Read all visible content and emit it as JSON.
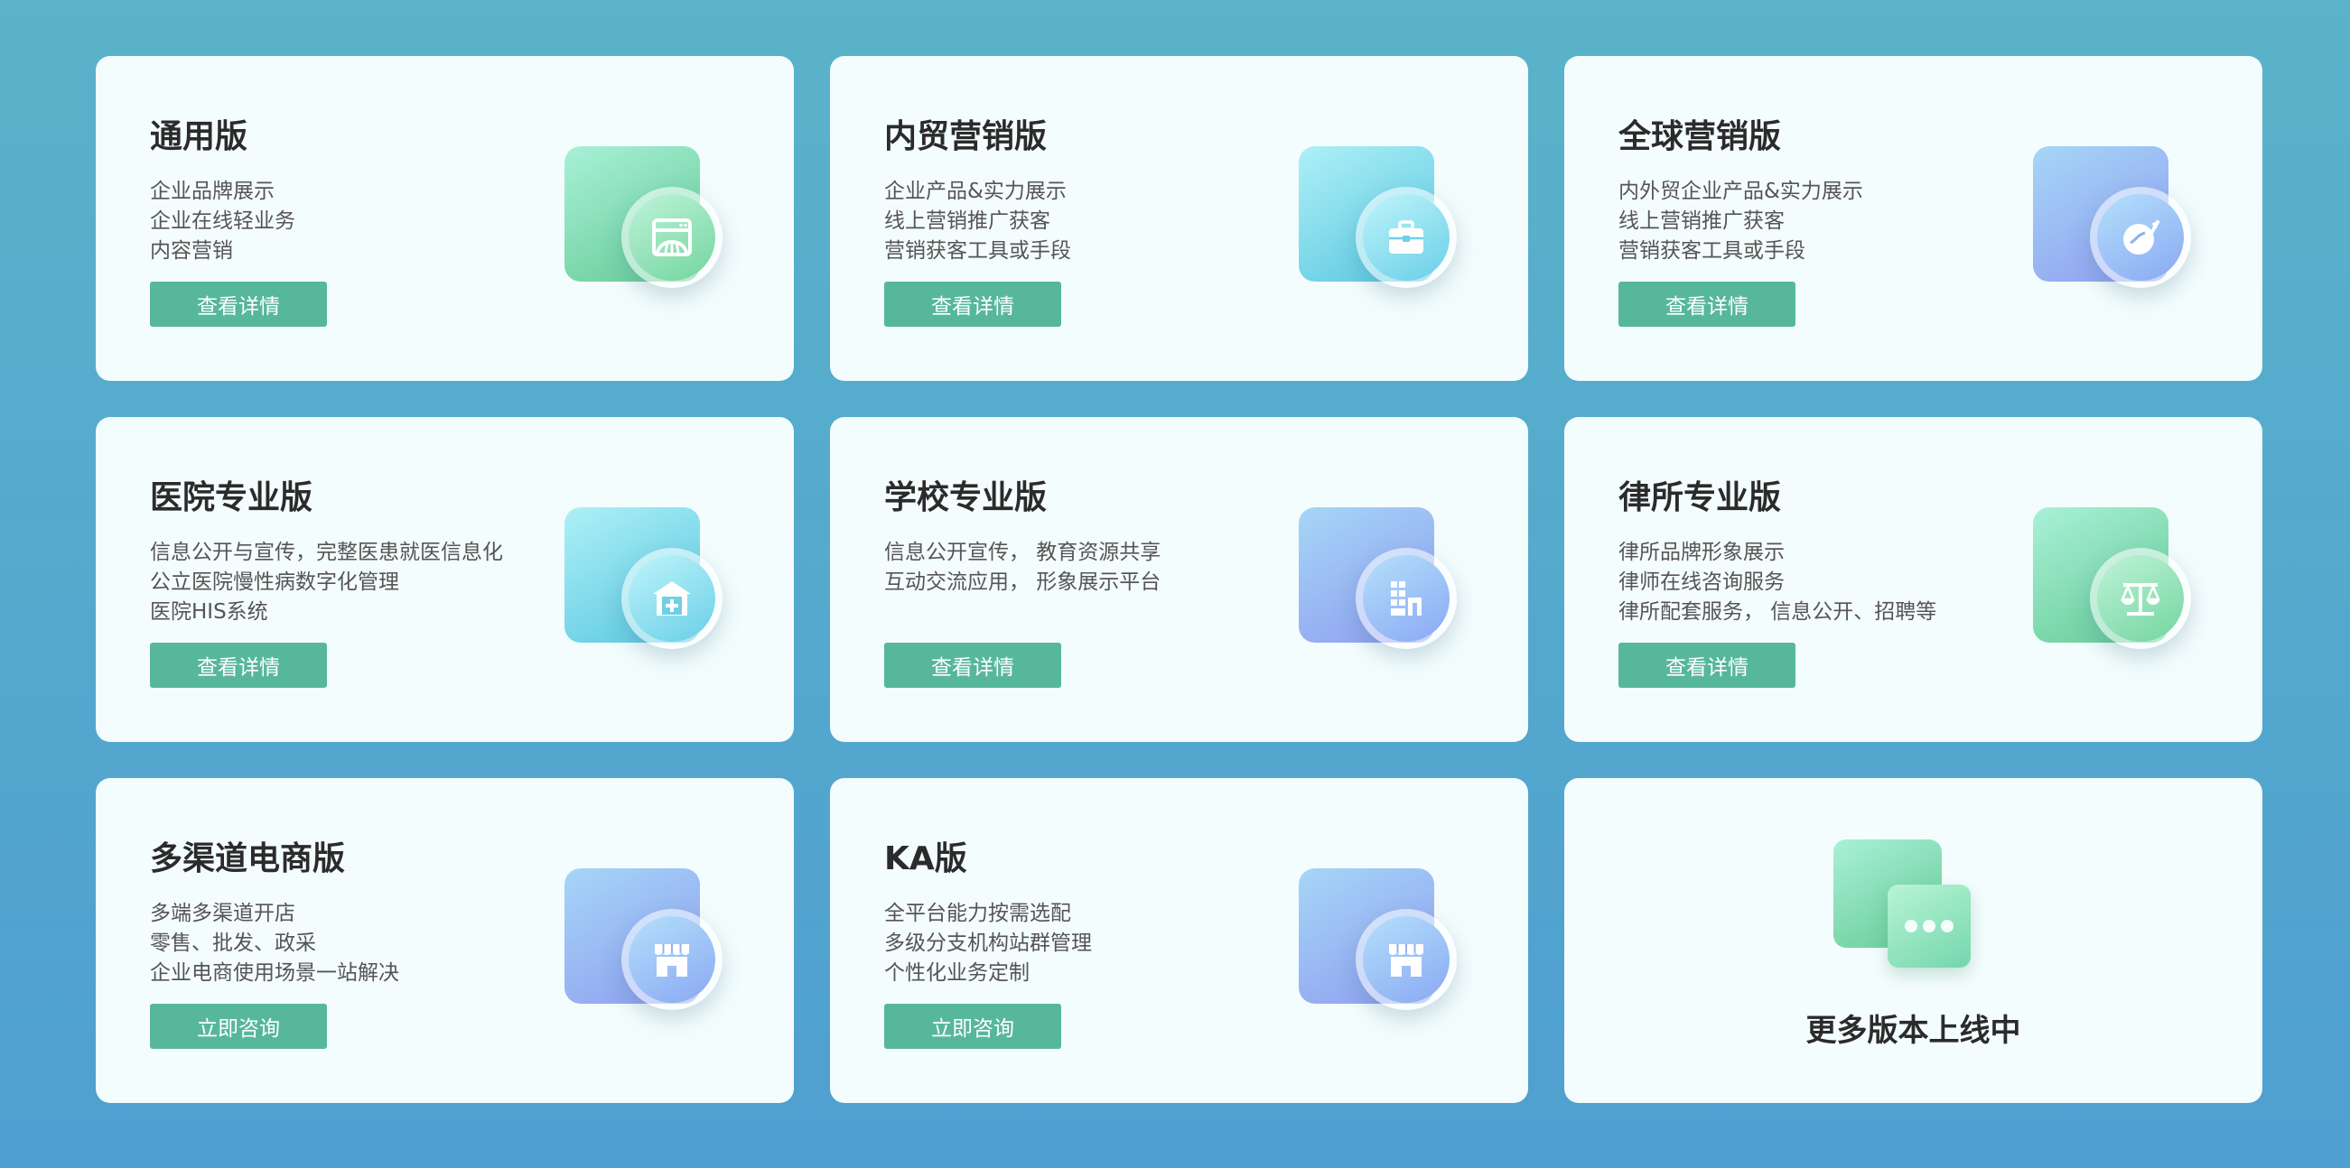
{
  "cards": [
    {
      "title": "通用版",
      "lines": [
        "企业品牌展示",
        "企业在线轻业务",
        "内容营销"
      ],
      "button": "查看详情",
      "icon": "storefront-icon",
      "theme": "green"
    },
    {
      "title": "内贸营销版",
      "lines": [
        "企业产品&实力展示",
        "线上营销推广获客",
        "营销获客工具或手段"
      ],
      "button": "查看详情",
      "icon": "briefcase-icon",
      "theme": "cyan"
    },
    {
      "title": "全球营销版",
      "lines": [
        "内外贸企业产品&实力展示",
        "线上营销推广获客",
        "营销获客工具或手段"
      ],
      "button": "查看详情",
      "icon": "globe-icon",
      "theme": "blue"
    },
    {
      "title": "医院专业版",
      "lines": [
        "信息公开与宣传，完整医患就医信息化",
        "公立医院慢性病数字化管理",
        "医院HIS系统"
      ],
      "button": "查看详情",
      "icon": "hospital-icon",
      "theme": "cyan"
    },
    {
      "title": "学校专业版",
      "lines": [
        "信息公开宣传， 教育资源共享",
        "互动交流应用， 形象展示平台"
      ],
      "button": "查看详情",
      "icon": "school-building-icon",
      "theme": "blue"
    },
    {
      "title": "律所专业版",
      "lines": [
        "律所品牌形象展示",
        "律师在线咨询服务",
        "律所配套服务， 信息公开、招聘等"
      ],
      "button": "查看详情",
      "icon": "scales-icon",
      "theme": "green"
    },
    {
      "title": "多渠道电商版",
      "lines": [
        "多端多渠道开店",
        "零售、批发、政采",
        "企业电商使用场景一站解决"
      ],
      "button": "立即咨询",
      "icon": "shop-icon",
      "theme": "blue"
    },
    {
      "title": "KA版",
      "lines": [
        "全平台能力按需选配",
        "多级分支机构站群管理",
        "个性化业务定制"
      ],
      "button": "立即咨询",
      "icon": "shop-icon",
      "theme": "blue"
    }
  ],
  "more": {
    "title": "更多版本上线中",
    "icon": "more-dots-icon"
  },
  "colors": {
    "button": "#57b79b",
    "card_bg": "#f4fdfd",
    "bg_top": "#5ab3c9",
    "bg_bottom": "#4f9fd1"
  }
}
